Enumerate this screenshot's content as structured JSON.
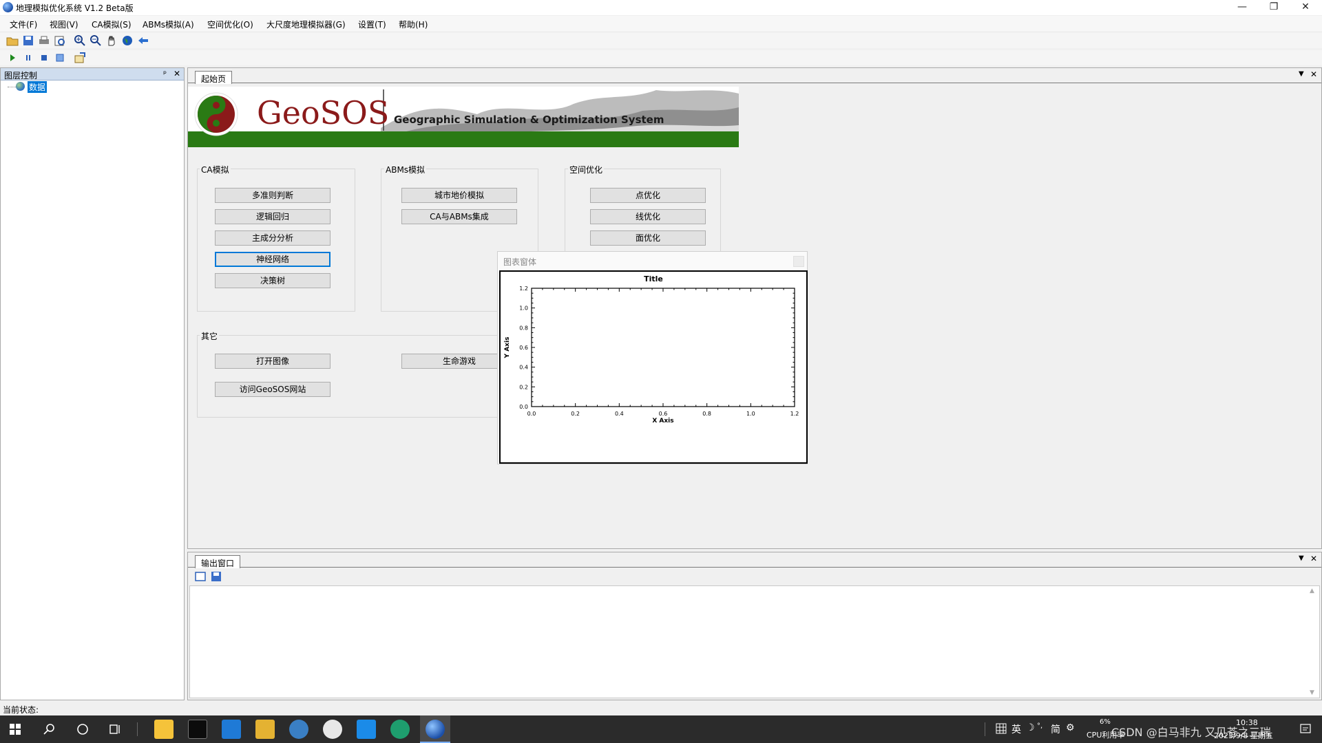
{
  "window": {
    "title": "地理模拟优化系统 V1.2 Beta版",
    "minimize": "—",
    "restore": "❐",
    "close": "✕"
  },
  "menu": [
    "文件(F)",
    "视图(V)",
    "CA模拟(S)",
    "ABMs模拟(A)",
    "空间优化(O)",
    "大尺度地理模拟器(G)",
    "设置(T)",
    "帮助(H)"
  ],
  "toolbar1_icons": [
    "open-folder-icon",
    "save-icon",
    "print-icon",
    "print-preview-icon",
    "zoom-in-icon",
    "zoom-out-icon",
    "pan-hand-icon",
    "globe-icon",
    "back-arrow-icon"
  ],
  "toolbar2_icons": [
    "play-icon",
    "pause-icon",
    "stop-icon",
    "step-icon",
    "export-icon"
  ],
  "layer_panel": {
    "title": "图层控制",
    "pin": "ᵖ",
    "close": "✕",
    "tree_item": "数据"
  },
  "doc_tab": {
    "label": "起始页"
  },
  "banner": {
    "logo_text": "GeoSOS",
    "subtitle": "Geographic Simulation & Optimization System"
  },
  "groups": {
    "ca": {
      "label": "CA模拟",
      "buttons": [
        "多准则判断",
        "逻辑回归",
        "主成分分析",
        "神经网络",
        "决策树"
      ]
    },
    "abm": {
      "label": "ABMs模拟",
      "buttons": [
        "城市地价模拟",
        "CA与ABMs集成"
      ]
    },
    "spatial": {
      "label": "空间优化",
      "buttons": [
        "点优化",
        "线优化",
        "面优化"
      ]
    },
    "other": {
      "label": "其它",
      "buttons": [
        "打开图像",
        "生命游戏",
        "访问GeoSOS网站"
      ]
    }
  },
  "chart_window": {
    "caption": "图表窗体"
  },
  "chart_data": {
    "type": "scatter",
    "title": "Title",
    "xlabel": "X Axis",
    "ylabel": "Y Axis",
    "xlim": [
      0.0,
      1.2
    ],
    "ylim": [
      0.0,
      1.2
    ],
    "xticks": [
      "0.0",
      "0.2",
      "0.4",
      "0.6",
      "0.8",
      "1.0",
      "1.2"
    ],
    "yticks": [
      "0.0",
      "0.2",
      "0.4",
      "0.6",
      "0.8",
      "1.0",
      "1.2"
    ],
    "series": []
  },
  "output_panel": {
    "tab": "输出窗口"
  },
  "status": {
    "label": "当前状态:"
  },
  "taskbar": {
    "tray_text": "英",
    "ime": "简",
    "cpu_percent": "6%",
    "cpu_label": "CPU利用率",
    "time": "10:38",
    "date": "2023/9/8 星期五",
    "watermark": "CSDN @白马非九 又见苍之三瑞"
  },
  "colors": {
    "accent": "#0078d7",
    "banner_green": "#2a7a14",
    "banner_red": "#8b1a1a"
  }
}
